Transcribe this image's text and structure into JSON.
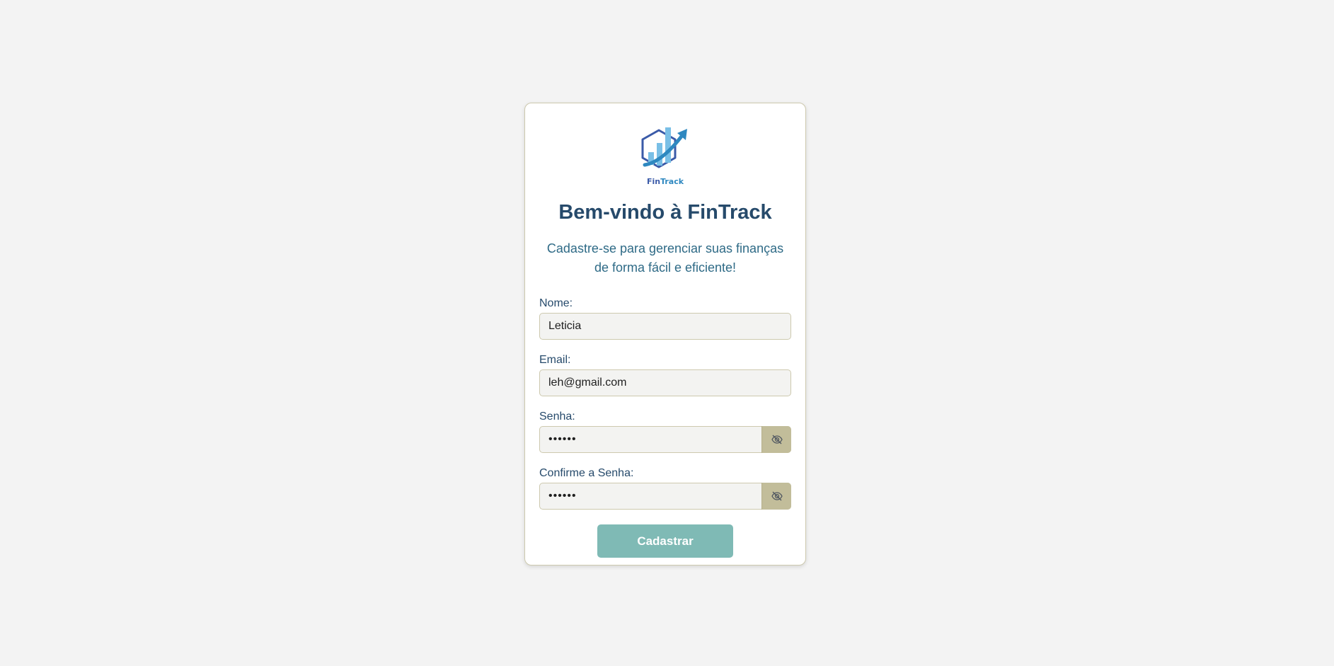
{
  "brand": {
    "logo_text_fin": "Fin",
    "logo_text_track": "Track",
    "colors": {
      "navy": "#3a5aa8",
      "blue": "#2e88c0",
      "light_blue": "#79bfe6",
      "title": "#264a6b",
      "subtitle": "#2e6a86"
    }
  },
  "header": {
    "title": "Bem-vindo à FinTrack",
    "subtitle": "Cadastre-se para gerenciar suas finanças de forma fácil e eficiente!"
  },
  "form": {
    "name": {
      "label": "Nome:",
      "value": "Leticia"
    },
    "email": {
      "label": "Email:",
      "value": "leh@gmail.com"
    },
    "password": {
      "label": "Senha:",
      "value": "••••••",
      "toggle_icon": "eye-slash-icon"
    },
    "confirm_password": {
      "label": "Confirme a Senha:",
      "value": "••••••",
      "toggle_icon": "eye-slash-icon"
    },
    "submit_label": "Cadastrar",
    "submit_color": "#7fbab5",
    "toggle_color": "#c2bd9a"
  }
}
